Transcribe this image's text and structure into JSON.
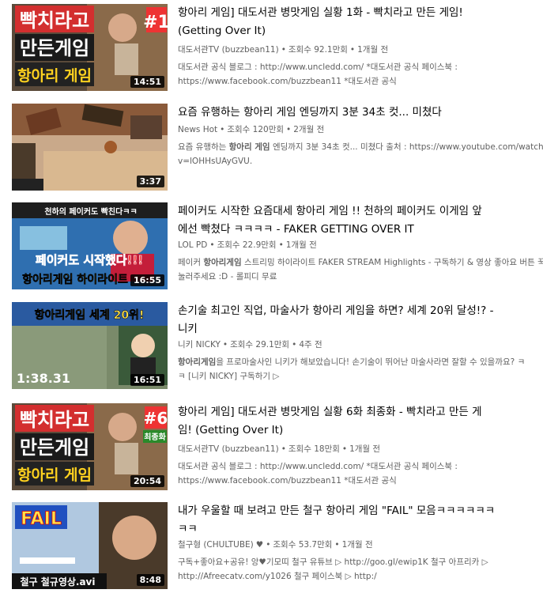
{
  "videos": [
    {
      "duration": "14:51",
      "title_line1": "항아리 게임] 대도서관 병맛게임 실황 1화 - 빡치라고 만든 게임!",
      "title_line2": "(Getting Over It)",
      "channel": "대도서관TV (buzzbean11)",
      "views": "조회수 92.1만회",
      "age": "1개월 전",
      "desc_line1": "대도서관 공식 블로그 : http://www.uncledd.com/ *대도서관 공식 페이스북 :",
      "desc_line2": "https://www.facebook.com/buzzbean11 *대도서관 공식",
      "thumb_text1": "빡치라고",
      "thumb_text2": "만든게임",
      "thumb_text3": "항아리 게임",
      "thumb_badge": "#1"
    },
    {
      "duration": "3:37",
      "title_line1": "요즘 유행하는 항아리 게임 엔딩까지 3분 34초 컷... 미쳤다",
      "title_line2": "",
      "channel": "News Hot",
      "views": "조회수 120만회",
      "age": "2개월 전",
      "desc_pre": "요즘 유행하는 ",
      "desc_bold": "항아리 게임",
      "desc_post": " 엔딩까지 3분 34초 컷... 미쳤다 출처 : https://www.youtube.com/watch?",
      "desc_line2": "v=lOHHsUAyGVU."
    },
    {
      "duration": "16:55",
      "title_line1": "페이커도 시작한 요즘대세 항아리 게임 !! 천하의 페이커도 이게임 앞",
      "title_line2": "에선 빡쳤다 ㅋㅋㅋㅋ - FAKER GETTING OVER IT",
      "channel": "LOL PD",
      "views": "조회수 22.9만회",
      "age": "1개월 전",
      "desc_pre": "페이커 ",
      "desc_bold": "항아리게임",
      "desc_post": " 스트리밍 하이라이트 FAKER STREAM Highlights - 구독하기 & 영상 좋아요 버튼 꾹",
      "desc_line2": "눌러주세요 :D - 롤피디 무료",
      "thumb_text_top": "천하의 페이커도 빡친다ㅋㅋ",
      "thumb_text1": "페이커도 시작했다!!!",
      "thumb_text2": "항아리게임 하이라이트"
    },
    {
      "duration": "16:51",
      "title_line1": "손기술 최고인 직업, 마술사가 항아리 게임을 하면? 세계 20위 달성!? -",
      "title_line2": "니키",
      "channel": "니키 NICKY",
      "views": "조회수 29.1만회",
      "age": "4주 전",
      "desc_pre": "",
      "desc_bold": "항아리게임",
      "desc_post": "을 프로마술사인 니키가 해보았습니다! 손기술이 뛰어난 마술사라면 잘할 수 있을까요? ㅋ",
      "desc_line2": "ㅋ [니키 NICKY] 구독하기 ▷",
      "thumb_text1": "항아리게임 세계 20위!",
      "thumb_timer": "1:38.31"
    },
    {
      "duration": "20:54",
      "title_line1": "항아리 게임] 대도서관 병맛게임 실황 6화 최종화 - 빡치라고 만든 게",
      "title_line2": "임! (Getting Over It)",
      "channel": "대도서관TV (buzzbean11)",
      "views": "조회수 18만회",
      "age": "1개월 전",
      "desc_line1": "대도서관 공식 블로그 : http://www.uncledd.com/ *대도서관 공식 페이스북 :",
      "desc_line2": "https://www.facebook.com/buzzbean11 *대도서관 공식",
      "thumb_text1": "빡치라고",
      "thumb_text2": "만든게임",
      "thumb_text3": "항아리 게임",
      "thumb_badge": "#6",
      "thumb_badge2": "최종화"
    },
    {
      "duration": "8:48",
      "title_line1": "내가 우울할 때 보려고 만든 철구 항아리 게임 \"FAIL\" 모음ㅋㅋㅋㅋㅋㅋ",
      "title_line2": "ㅋㅋ",
      "channel": "철구형 (CHULTUBE)",
      "verified": "♥",
      "views": "조회수 53.7만회",
      "age": "1개월 전",
      "desc_line1": "구독+좋아요+공유! 앙♥기모띠 철구 유튜브 ▷ http://goo.gl/ewip1K 철구 아프리카 ▷",
      "desc_line2": "http://Afreecatv.com/y1026 철구 페이스북 ▷ http:/",
      "thumb_text1": "FAIL",
      "thumb_text2": "철구 철규영상.avi"
    }
  ]
}
